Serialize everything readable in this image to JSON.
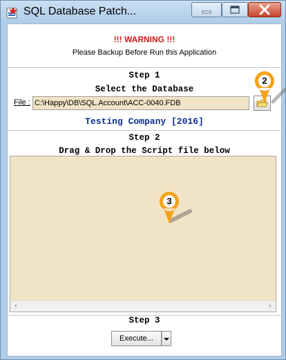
{
  "window": {
    "title": "SQL Database Patch..."
  },
  "warning": {
    "title": "!!! WARNING !!!",
    "message": "Please Backup Before Run this Application"
  },
  "step1": {
    "heading": "Step 1",
    "subheading": "Select the Database",
    "file_label": "File :",
    "file_value": "C:\\Happy\\DB\\SQL.Account\\ACC-0040.FDB"
  },
  "company": "Testing Company [2016]",
  "step2": {
    "heading": "Step 2",
    "subheading": "Drag & Drop the Script file below"
  },
  "step3": {
    "heading": "Step 3",
    "execute_label": "Execute..."
  },
  "callouts": {
    "browse": "2",
    "dropzone": "3"
  },
  "icons": {
    "app": "app-icon",
    "minimize": "minimize-icon",
    "maximize": "maximize-icon",
    "close": "close-icon",
    "browse": "folder-icon",
    "dropdown": "chevron-down-icon",
    "scroll_left": "chevron-left-icon",
    "scroll_right": "chevron-right-icon"
  },
  "colors": {
    "warning": "#d01818",
    "company": "#0e2f8e",
    "field_bg": "#f1e3c5",
    "callout": "#f5a21b"
  }
}
